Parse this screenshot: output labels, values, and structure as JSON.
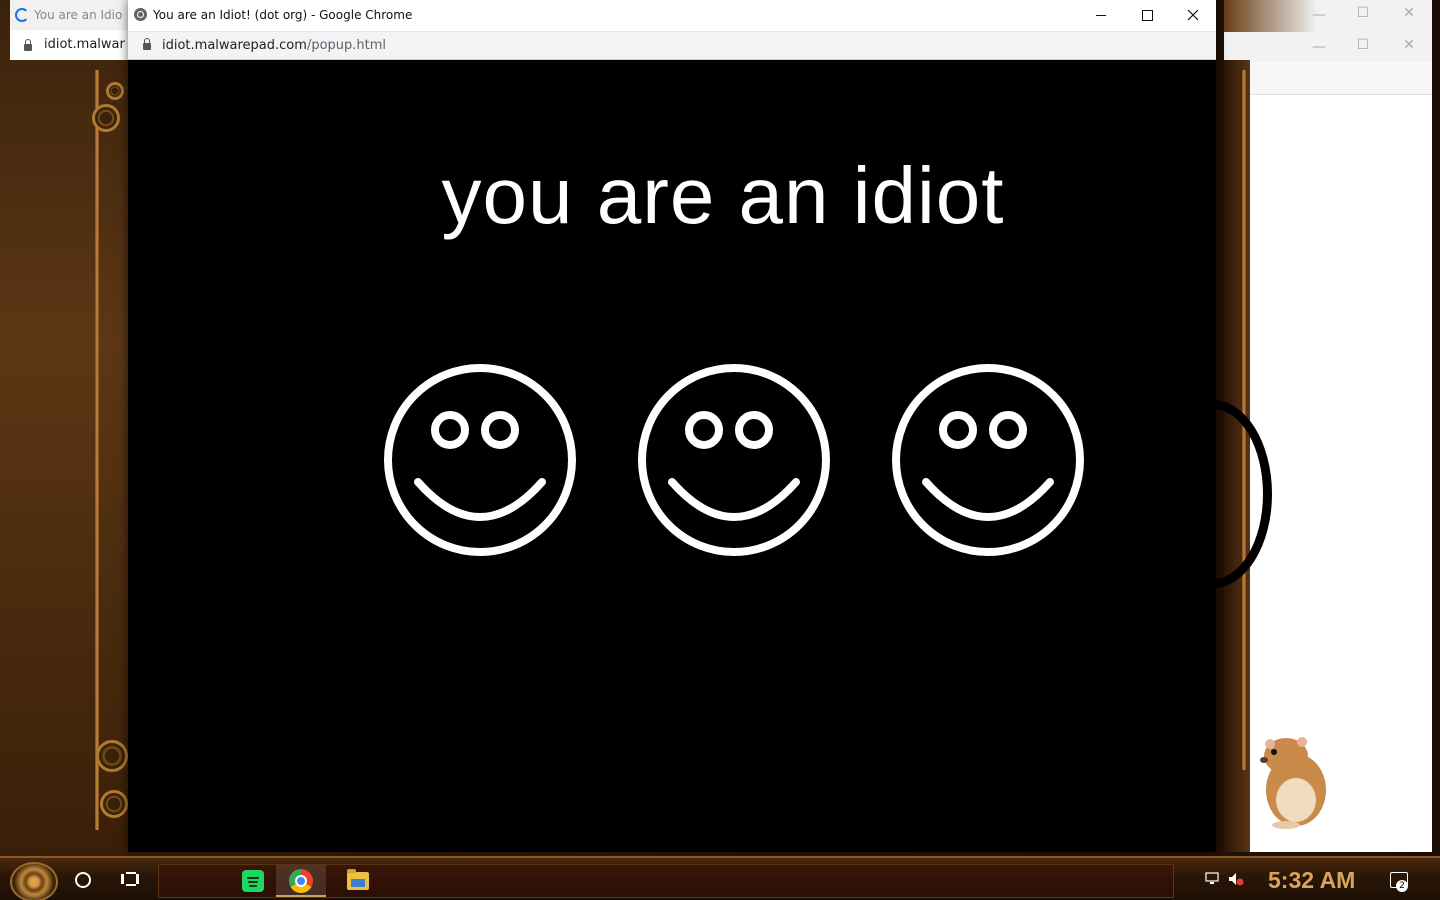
{
  "main_window": {
    "title": "You are an Idiot! (dot org) - Google Chrome",
    "url_host": "idiot.malwarepad.com",
    "url_path": "/popup.html",
    "headline": "you are an idiot",
    "smiley_count": 3
  },
  "back_window_left": {
    "title": "You are an Idio",
    "url": "idiot.malwar"
  },
  "back_window_right": {
    "minimize": "—",
    "maximize": "☐",
    "close": "✕"
  },
  "taskbar": {
    "clock": "5:32 AM",
    "notification_count": "2",
    "apps": [
      "spotify",
      "chrome",
      "file-explorer"
    ],
    "active_app": "chrome"
  },
  "colors": {
    "popup_background": "#000000",
    "headline": "#ffffff",
    "clock": "#d8a65a",
    "taskbar": "#2a1606"
  }
}
